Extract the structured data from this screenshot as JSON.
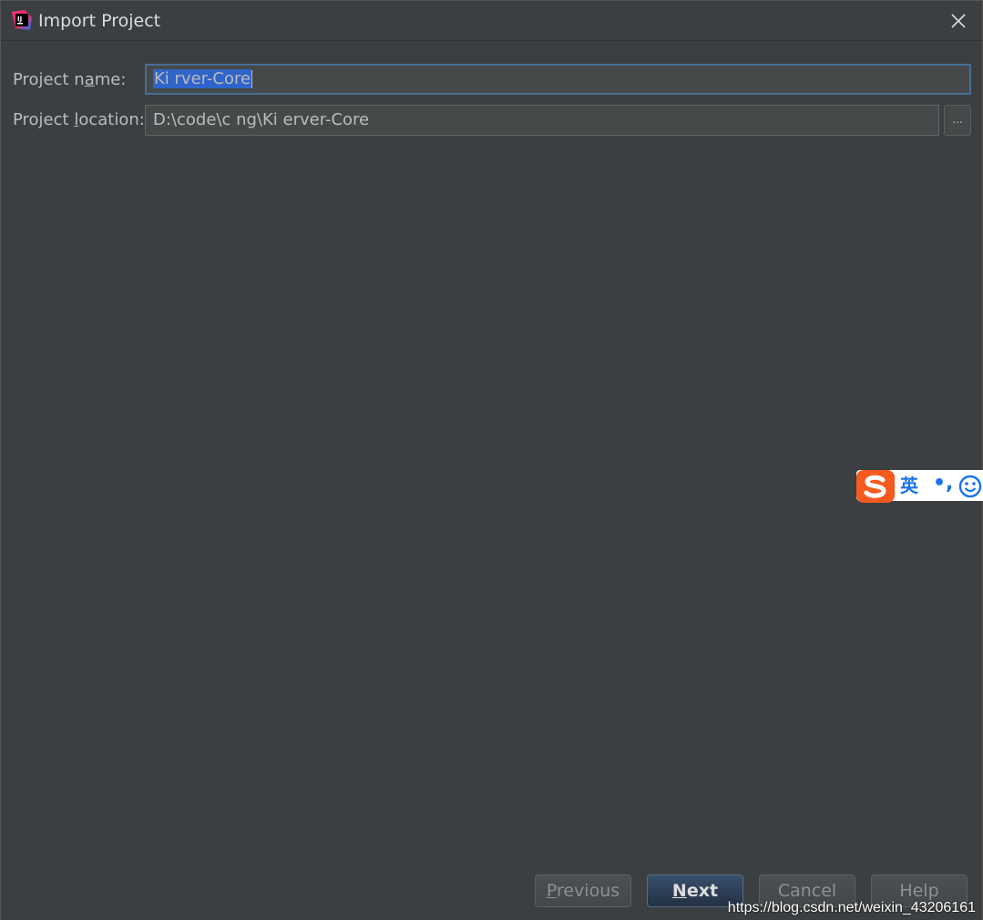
{
  "window": {
    "title": "Import Project",
    "app_icon": "intellij-idea-icon",
    "close_icon": "close-icon"
  },
  "form": {
    "project_name": {
      "label_prefix": "Project n",
      "label_mnemonic": "a",
      "label_suffix": "me:",
      "value": "Ki     rver-Core"
    },
    "project_location": {
      "label_prefix": "Project ",
      "label_mnemonic": "l",
      "label_suffix": "ocation:",
      "value": "D:\\code\\c      ng\\Ki     erver-Core",
      "browse_label": "..."
    }
  },
  "buttons": {
    "previous": {
      "mnemonic": "P",
      "rest": "revious"
    },
    "next": {
      "mnemonic": "N",
      "rest": "ext"
    },
    "cancel": "Cancel",
    "help": "Help"
  },
  "ime_toolbar": {
    "logo": "sogou-s-icon",
    "language": "英",
    "punctuation": "•,",
    "emoji": "smiley-icon"
  },
  "watermark": "https://blog.csdn.net/weixin_43206161",
  "colors": {
    "background": "#3c3f41",
    "field_background": "#45494a",
    "focus_border": "#466d94",
    "selection": "#2f65ca",
    "primary_button": "#2c3e55"
  }
}
